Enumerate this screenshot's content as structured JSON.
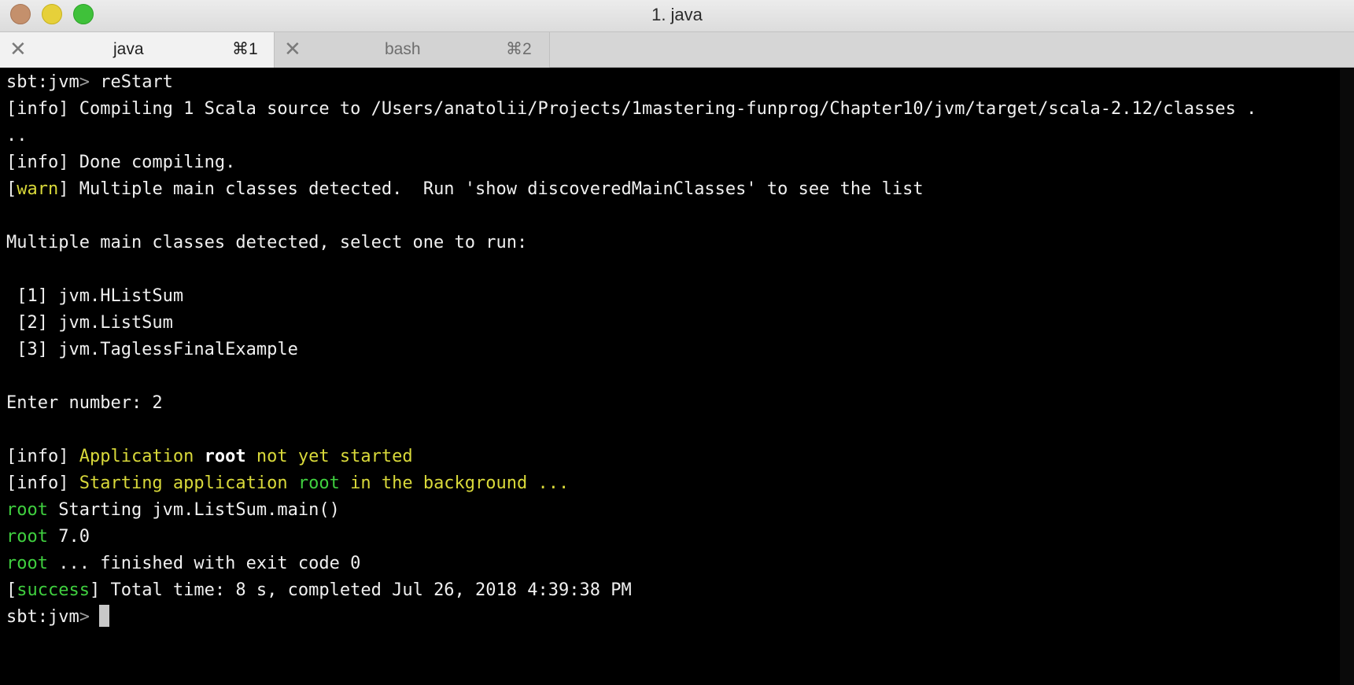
{
  "window": {
    "title": "1. java"
  },
  "tabs": [
    {
      "label": "java",
      "shortcut": "⌘1",
      "close": "✕",
      "active": true
    },
    {
      "label": "bash",
      "shortcut": "⌘2",
      "close": "✕",
      "active": false
    }
  ],
  "terminal": {
    "line1": {
      "prompt": "sbt:jvm",
      "prompt_sym": ">",
      "cmd": " reStart"
    },
    "line2": "[info] Compiling 1 Scala source to /Users/anatolii/Projects/1mastering-funprog/Chapter10/jvm/target/scala-2.12/classes .",
    "line3": "..",
    "line4": "[info] Done compiling.",
    "line5": {
      "open": "[",
      "tag": "warn",
      "close": "]",
      "text": " Multiple main classes detected.  Run 'show discoveredMainClasses' to see the list"
    },
    "line6": "Multiple main classes detected, select one to run:",
    "line7": " [1] jvm.HListSum",
    "line8": " [2] jvm.ListSum",
    "line9": " [3] jvm.TaglessFinalExample",
    "line10": "Enter number: 2",
    "line11": {
      "tag": "[info] ",
      "a": "Application ",
      "b": "root",
      "c": " not yet started"
    },
    "line12": {
      "tag": "[info] ",
      "a": "Starting application ",
      "b": "root",
      "c": " in the background ..."
    },
    "line13": {
      "label": "root",
      "text": " Starting jvm.ListSum.main()"
    },
    "line14": {
      "label": "root",
      "text": " 7.0"
    },
    "line15": {
      "label": "root",
      "text": " ... finished with exit code 0"
    },
    "line16": {
      "open": "[",
      "tag": "success",
      "close": "]",
      "text": " Total time: 8 s, completed Jul 26, 2018 4:39:38 PM"
    },
    "line17": {
      "prompt": "sbt:jvm",
      "prompt_sym": ">"
    }
  },
  "colors": {
    "background": "#000000",
    "text": "#f0f0f0",
    "warn_yellow": "#d9d93a",
    "success_green": "#3fcf3f"
  }
}
